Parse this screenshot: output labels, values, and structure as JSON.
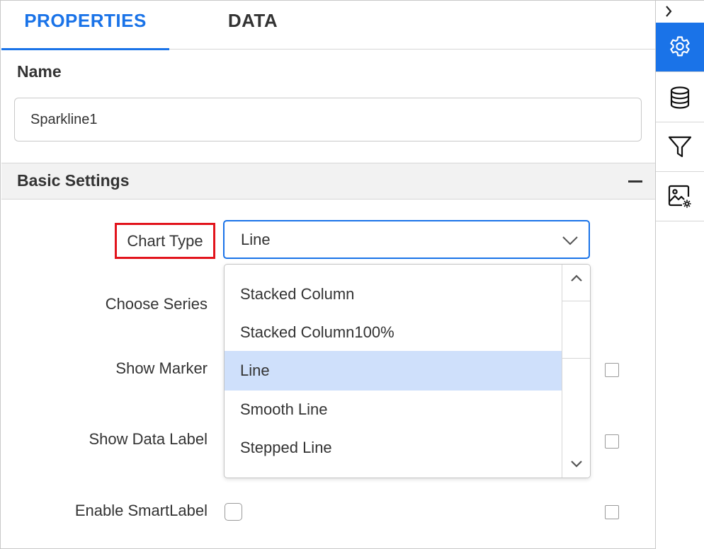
{
  "tabs": [
    {
      "label": "PROPERTIES",
      "active": true
    },
    {
      "label": "DATA",
      "active": false
    }
  ],
  "name_section": {
    "label": "Name",
    "value": "Sparkline1"
  },
  "basic_settings": {
    "title": "Basic Settings",
    "collapse_icon": "minus-icon",
    "chart_type": {
      "label": "Chart Type",
      "value": "Line",
      "highlight_color": "#e2141c"
    },
    "choose_series": {
      "label": "Choose Series"
    },
    "show_marker": {
      "label": "Show Marker",
      "checked": false
    },
    "show_data_label": {
      "label": "Show Data Label",
      "checked": false
    },
    "enable_smartlabel": {
      "label": "Enable SmartLabel",
      "checked": false
    }
  },
  "dropdown": {
    "options": [
      "Stacked Column",
      "Stacked Column100%",
      "Line",
      "Smooth Line",
      "Stepped Line"
    ],
    "selected": "Line"
  },
  "sidebar": {
    "toggle_icon": "chevron-right-icon",
    "icons": [
      {
        "name": "gear-icon",
        "active": true
      },
      {
        "name": "database-icon",
        "active": false
      },
      {
        "name": "filter-icon",
        "active": false
      },
      {
        "name": "image-settings-icon",
        "active": false
      }
    ]
  },
  "colors": {
    "accent": "#1a73e8",
    "selected_option_bg": "#cfe0fb",
    "section_header_bg": "#f2f2f2"
  }
}
